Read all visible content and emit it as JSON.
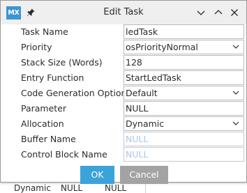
{
  "window": {
    "title": "Edit Task",
    "logo_text": "MX",
    "icons": [
      "pin-icon",
      "chevron-down-icon",
      "chevron-up-icon",
      "close-icon"
    ]
  },
  "form": {
    "rows": [
      {
        "label": "Task Name",
        "value": "ledTask",
        "type": "text"
      },
      {
        "label": "Priority",
        "value": "osPriorityNormal",
        "type": "combo"
      },
      {
        "label": "Stack Size (Words)",
        "value": "128",
        "type": "text"
      },
      {
        "label": "Entry Function",
        "value": "StartLedTask",
        "type": "text"
      },
      {
        "label": "Code Generation Option",
        "value": "Default",
        "type": "combo"
      },
      {
        "label": "Parameter",
        "value": "NULL",
        "type": "text"
      },
      {
        "label": "Allocation",
        "value": "Dynamic",
        "type": "combo"
      },
      {
        "label": "Buffer Name",
        "value": "NULL",
        "type": "disabled"
      },
      {
        "label": "Control Block Name",
        "value": "NULL",
        "type": "disabled"
      }
    ]
  },
  "buttons": {
    "ok": "OK",
    "cancel": "Cancel"
  },
  "background": {
    "cells": [
      "Dynamic",
      "NULL",
      "NULL"
    ]
  },
  "colors": {
    "accent": "#3ca3d9",
    "logo": "#3c95d2",
    "cancel": "#a3a3a3",
    "disabled_text": "#a9c7e6"
  }
}
